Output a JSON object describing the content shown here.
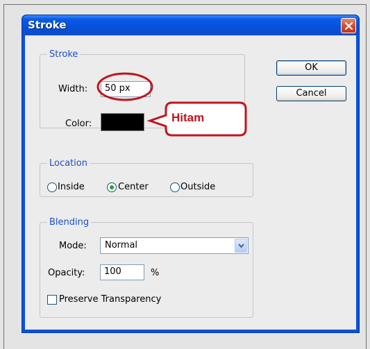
{
  "dialog": {
    "title": "Stroke",
    "close_icon": "close-icon"
  },
  "stroke": {
    "legend": "Stroke",
    "width_label": "Width:",
    "width_value": "50 px",
    "color_label": "Color:",
    "color": "#000000"
  },
  "callout": {
    "text": "Hitam",
    "color": "#c2151d"
  },
  "location": {
    "legend": "Location",
    "options": [
      "Inside",
      "Center",
      "Outside"
    ],
    "selected": "Center"
  },
  "blending": {
    "legend": "Blending",
    "mode_label": "Mode:",
    "mode_value": "Normal",
    "opacity_label": "Opacity:",
    "opacity_value": "100",
    "opacity_unit": "%",
    "preserve_label": "Preserve Transparency",
    "preserve_checked": false
  },
  "buttons": {
    "ok": "OK",
    "cancel": "Cancel"
  },
  "colors": {
    "titlebar": "#0a53d8",
    "legend_text": "#1a50c8",
    "annotation_red": "#c2151d"
  }
}
